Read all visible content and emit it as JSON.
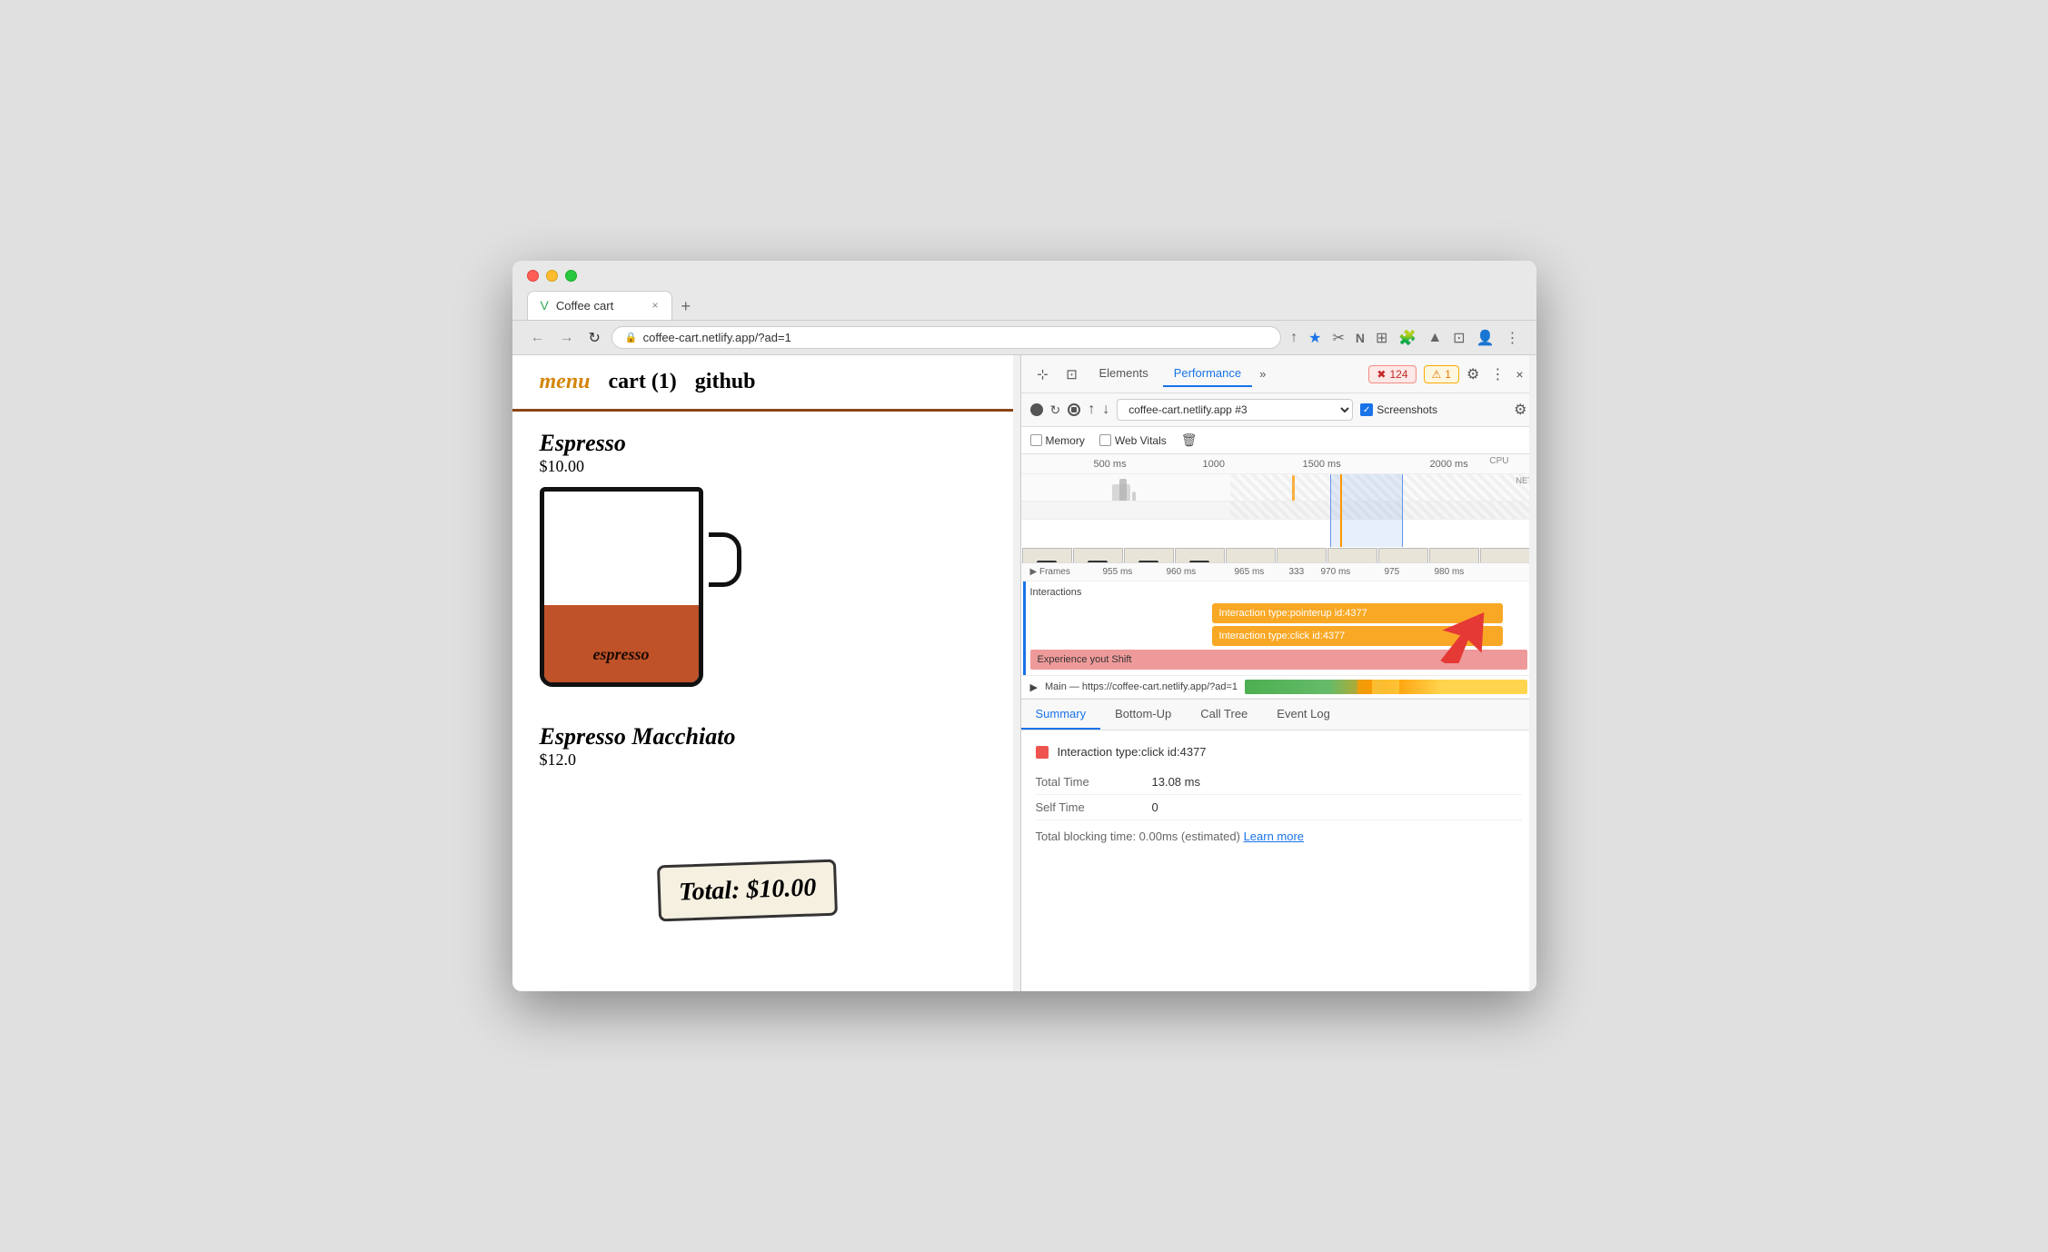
{
  "browser": {
    "traffic_lights": [
      "red",
      "yellow",
      "green"
    ],
    "tab": {
      "favicon": "V",
      "title": "Coffee cart",
      "close_label": "×"
    },
    "new_tab_label": "+",
    "address_bar": {
      "url": "coffee-cart.netlify.app/?ad=1",
      "lock_icon": "🔒"
    },
    "nav": {
      "back": "←",
      "forward": "→",
      "refresh": "↻"
    },
    "toolbar_icons": [
      "↑",
      "★",
      "✂",
      "n",
      "⊞",
      "🧩",
      "▲",
      "⊡",
      "👤",
      "⋮"
    ]
  },
  "website": {
    "nav": {
      "menu": "menu",
      "cart": "cart (1)",
      "github": "github"
    },
    "espresso": {
      "name": "Espresso",
      "price": "$10.00",
      "label": "espresso"
    },
    "espresso_macchiato": {
      "name": "Espresso Macchiato",
      "price": "$12.0"
    },
    "total_badge": "Total: $10.00"
  },
  "devtools": {
    "tabs": [
      "Elements",
      "Performance",
      "»"
    ],
    "active_tab": "Performance",
    "error_count": "124",
    "warning_count": "1",
    "settings_label": "⚙",
    "dots_label": "⋮",
    "close_label": "×",
    "recording": {
      "record_label": "●",
      "refresh_label": "↻",
      "stop_label": "⊘",
      "upload_label": "↑",
      "download_label": "↓",
      "target": "coffee-cart.netlify.app #3",
      "screenshots_label": "Screenshots"
    },
    "checks": {
      "memory": "Memory",
      "web_vitals": "Web Vitals",
      "trash": "🗑"
    },
    "timeline": {
      "labels": [
        "500 ms",
        "1000",
        "1500 ms",
        "2000 ms"
      ],
      "cpu_label": "CPU",
      "net_label": "NET",
      "frames_label": "Frames",
      "time_markers": [
        "955 ms",
        "960 ms",
        "965 ms",
        "333",
        "970 ms",
        "975",
        "980 ms"
      ]
    },
    "interactions": {
      "label": "Interactions",
      "items": [
        "Interaction type:pointerup id:4377",
        "Interaction type:click id:4377"
      ]
    },
    "layout_shift": "Experience yout Shift",
    "main_thread": "Main — https://coffee-cart.netlify.app/?ad=1",
    "bottom_tabs": [
      "Summary",
      "Bottom-Up",
      "Call Tree",
      "Event Log"
    ],
    "active_bottom_tab": "Summary",
    "summary": {
      "color": "#ef5350",
      "title": "Interaction type:click id:4377",
      "rows": [
        {
          "key": "Total Time",
          "value": "13.08 ms"
        },
        {
          "key": "Self Time",
          "value": "0"
        }
      ],
      "tbt": "Total blocking time: 0.00ms (estimated)",
      "learn_more": "Learn more"
    }
  }
}
